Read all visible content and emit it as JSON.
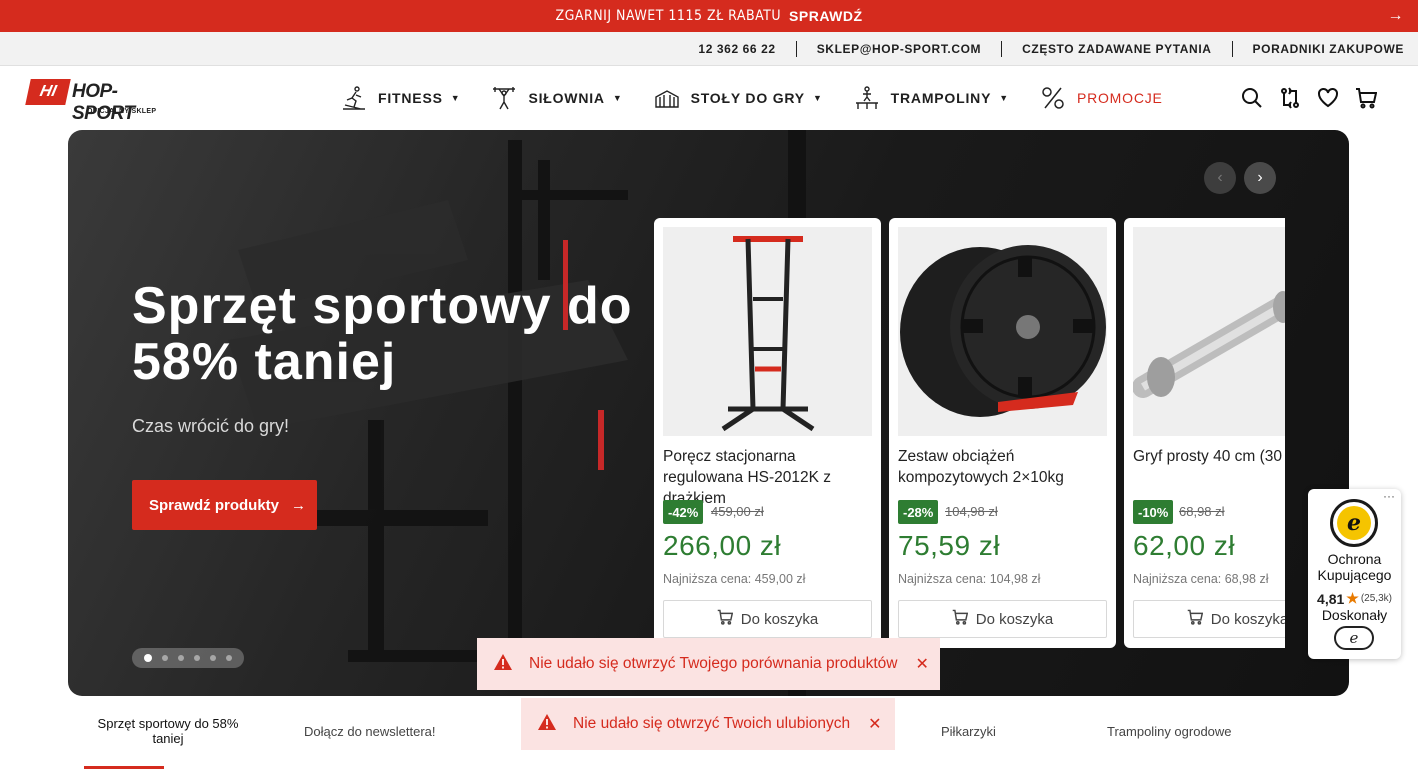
{
  "promo_bar": {
    "text": "ZGARNIJ NAWET 1115 ZŁ RABATU",
    "cta": "SPRAWDŹ",
    "arrow": "→"
  },
  "topinfo": {
    "phone": "12 362 66 22",
    "email": "SKLEP@HOP-SPORT.COM",
    "faq": "CZĘSTO ZADAWANE PYTANIA",
    "guides": "PORADNIKI ZAKUPOWE"
  },
  "logo": {
    "badge": "HI",
    "name": "HOP-SPORT",
    "sub": "OFICJALNY SKLEP"
  },
  "nav": [
    {
      "label": "FITNESS",
      "icon": "treadmill-icon"
    },
    {
      "label": "SIŁOWNIA",
      "icon": "weightlifter-icon"
    },
    {
      "label": "STOŁY DO GRY",
      "icon": "game-table-icon"
    },
    {
      "label": "TRAMPOLINY",
      "icon": "trampoline-icon"
    },
    {
      "label": "PROMOCJE",
      "icon": "percent-icon"
    }
  ],
  "header_icons": [
    "search-icon",
    "compare-icon",
    "heart-icon",
    "cart-icon"
  ],
  "hero": {
    "title": "Sprzęt sportowy do 58% taniej",
    "subtitle": "Czas wrócić do gry!",
    "button": "Sprawdź produkty",
    "button_arrow": "→",
    "slides": 6,
    "active_slide": 1
  },
  "carousel": {
    "prev": "‹",
    "next": "›"
  },
  "products": [
    {
      "name": "Poręcz stacjonarna regulowana HS-2012K z drążkiem",
      "discount": "-42%",
      "old_price": "459,00 zł",
      "price": "266,00 zł",
      "lowest": "Najniższa cena: 459,00 zł",
      "button": "Do koszyka"
    },
    {
      "name": "Zestaw obciążeń kompozytowych 2×10kg",
      "discount": "-28%",
      "old_price": "104,98 zł",
      "price": "75,59 zł",
      "lowest": "Najniższa cena: 104,98 zł",
      "button": "Do koszyka"
    },
    {
      "name": "Gryf prosty 40 cm (30",
      "discount": "-10%",
      "old_price": "68,98 zł",
      "price": "62,00 zł",
      "lowest": "Najniższa cena: 68,98 zł",
      "button": "Do koszyka"
    }
  ],
  "toasts": [
    {
      "text": "Nie udało się otwrzyć Twojego porównania produktów",
      "close": "✕"
    },
    {
      "text": "Nie udało się otwrzyć Twoich ulubionych",
      "close": "✕"
    }
  ],
  "trusted_shops": {
    "menu": "···",
    "seal": "e",
    "line1": "Ochrona Kupującego",
    "rating": "4,81",
    "count": "(25,3k)",
    "grade": "Doskonały",
    "logo": "e"
  },
  "tabs": [
    {
      "label": "Sprzęt sportowy do 58% taniej",
      "active": true
    },
    {
      "label": "Dołącz do newslettera!",
      "active": false
    },
    {
      "label": "Piłkarzyki",
      "active": false
    },
    {
      "label": "Trampoliny ogrodowe",
      "active": false
    }
  ],
  "colors": {
    "brand_red": "#d52b1e",
    "price_green": "#2e7d32",
    "toast_bg": "#fbe3e2"
  }
}
